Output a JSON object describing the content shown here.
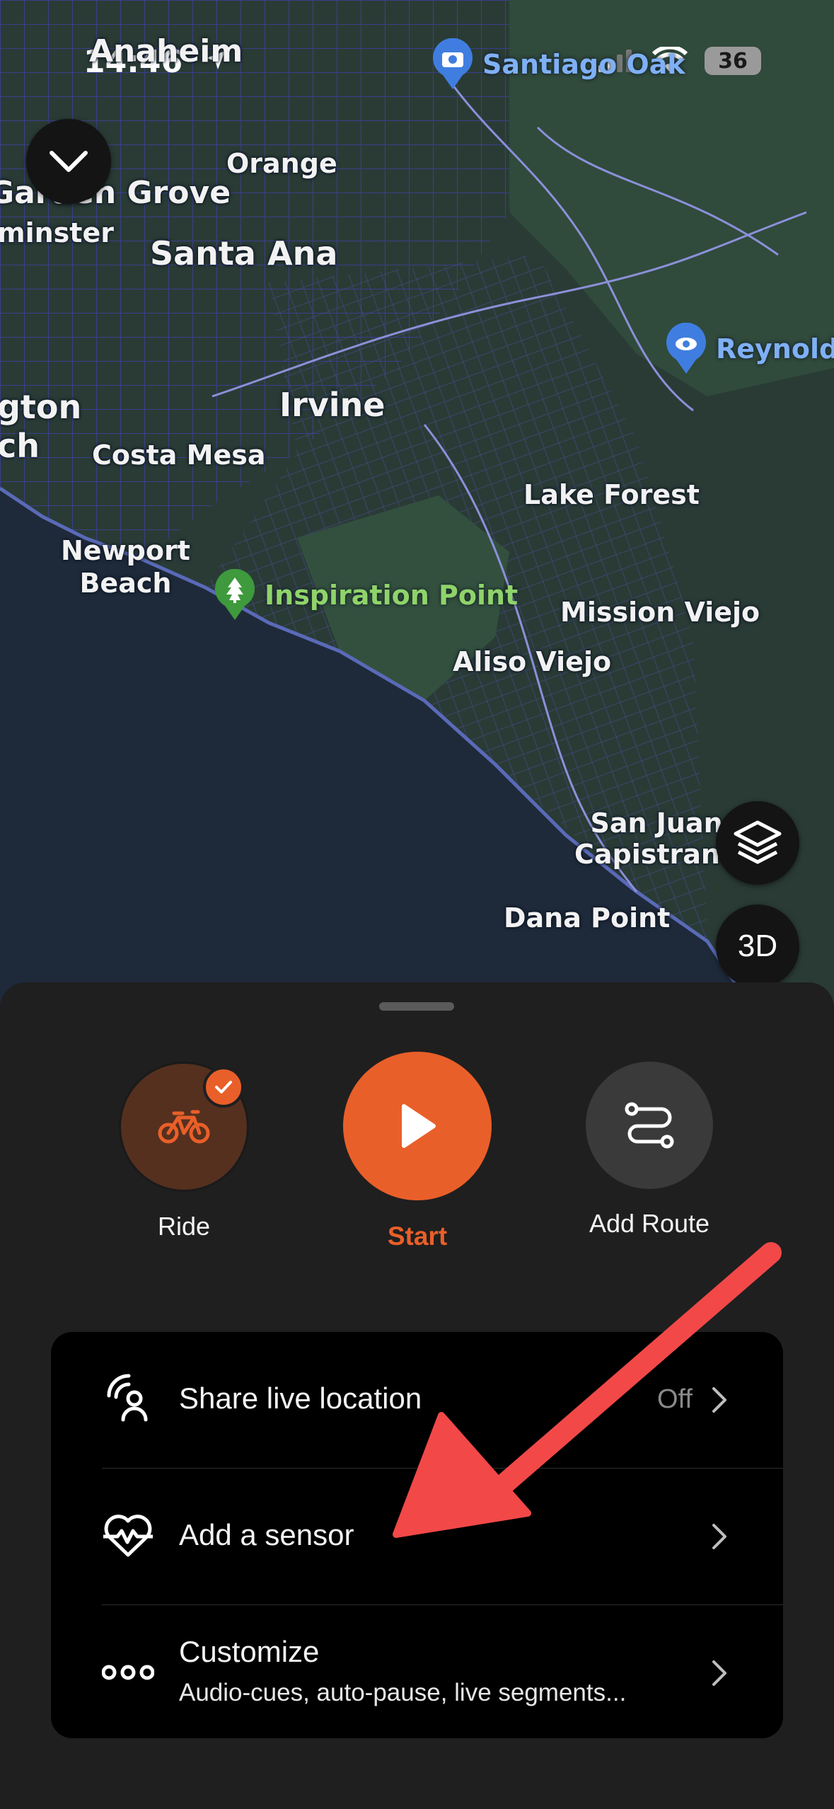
{
  "status_bar": {
    "time": "14:46",
    "battery": "36"
  },
  "map": {
    "places": [
      {
        "name": "Anaheim",
        "key": "anaheim"
      },
      {
        "name": "Orange",
        "key": "orange"
      },
      {
        "name": "Garden Grove",
        "key": "garden-grove"
      },
      {
        "name": "minster",
        "key": "westminster"
      },
      {
        "name": "Santa Ana",
        "key": "santa-ana"
      },
      {
        "name": "Irvine",
        "key": "irvine"
      },
      {
        "name": "gton\nch",
        "key": "huntington-beach"
      },
      {
        "name": "Costa Mesa",
        "key": "costa-mesa"
      },
      {
        "name": "Lake Forest",
        "key": "lake-forest"
      },
      {
        "name": "Newport\nBeach",
        "key": "newport-beach"
      },
      {
        "name": "Mission Viejo",
        "key": "mission-viejo"
      },
      {
        "name": "Aliso Viejo",
        "key": "aliso-viejo"
      },
      {
        "name": "San Juan\nCapistrano",
        "key": "san-juan-capistrano"
      },
      {
        "name": "Dana Point",
        "key": "dana-point"
      }
    ],
    "pois": {
      "santiago": "Santiago Oak",
      "reynolds": "Reynolds",
      "inspiration": "Inspiration Point"
    },
    "buttons": {
      "collapse": "collapse",
      "layers": "layers",
      "three_d": "3D"
    }
  },
  "actions": {
    "ride": "Ride",
    "start": "Start",
    "add_route": "Add Route"
  },
  "menu": {
    "share": {
      "label": "Share live location",
      "value": "Off"
    },
    "sensor": {
      "label": "Add a sensor"
    },
    "customize": {
      "label": "Customize",
      "sub": "Audio-cues, auto-pause, live segments..."
    }
  },
  "colors": {
    "accent": "#e95f29",
    "arrow": "#f24848",
    "map_land": "#2a3b36",
    "map_water": "#19293b"
  }
}
